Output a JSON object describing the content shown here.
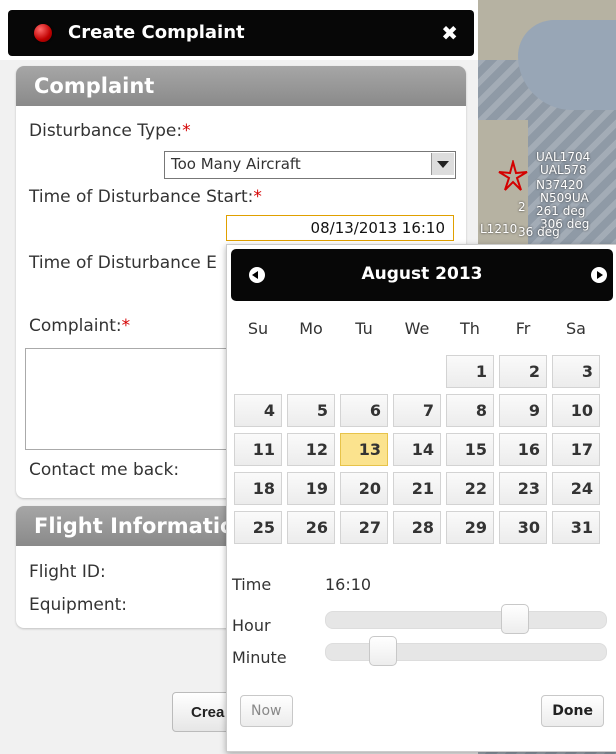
{
  "dialog": {
    "title": "Create Complaint",
    "close_glyph": "✖",
    "create_button_label": "Crea"
  },
  "complaint_section": {
    "title": "Complaint",
    "disturbance_type_label": "Disturbance Type:",
    "disturbance_type_value": "Too Many Aircraft",
    "time_start_label": "Time of Disturbance Start:",
    "time_start_value": "08/13/2013 16:10",
    "time_end_label": "Time of Disturbance E",
    "complaint_label": "Complaint:",
    "contact_label": "Contact me back:",
    "required_marker": "*"
  },
  "flight_section": {
    "title": "Flight Informatio",
    "flight_id_label": "Flight ID:",
    "equipment_label": "Equipment:"
  },
  "datepicker": {
    "month_title": "August 2013",
    "weekdays": [
      "Su",
      "Mo",
      "Tu",
      "We",
      "Th",
      "Fr",
      "Sa"
    ],
    "weeks": [
      [
        "",
        "",
        "",
        "",
        "1",
        "2",
        "3"
      ],
      [
        "4",
        "5",
        "6",
        "7",
        "8",
        "9",
        "10"
      ],
      [
        "11",
        "12",
        "13",
        "14",
        "15",
        "16",
        "17"
      ],
      [
        "18",
        "19",
        "20",
        "21",
        "22",
        "23",
        "24"
      ],
      [
        "25",
        "26",
        "27",
        "28",
        "29",
        "30",
        "31"
      ]
    ],
    "selected_day": "13",
    "time_label": "Time",
    "time_value": "16:10",
    "hour_label": "Hour",
    "minute_label": "Minute",
    "hour_value": 16,
    "minute_value": 10,
    "now_label": "Now",
    "done_label": "Done"
  },
  "map": {
    "labels": [
      "UAL1704",
      "UAL578",
      "N37420",
      "N509UA",
      "306 deg",
      "L1210",
      "36 deg",
      "261 deg",
      "2"
    ]
  }
}
